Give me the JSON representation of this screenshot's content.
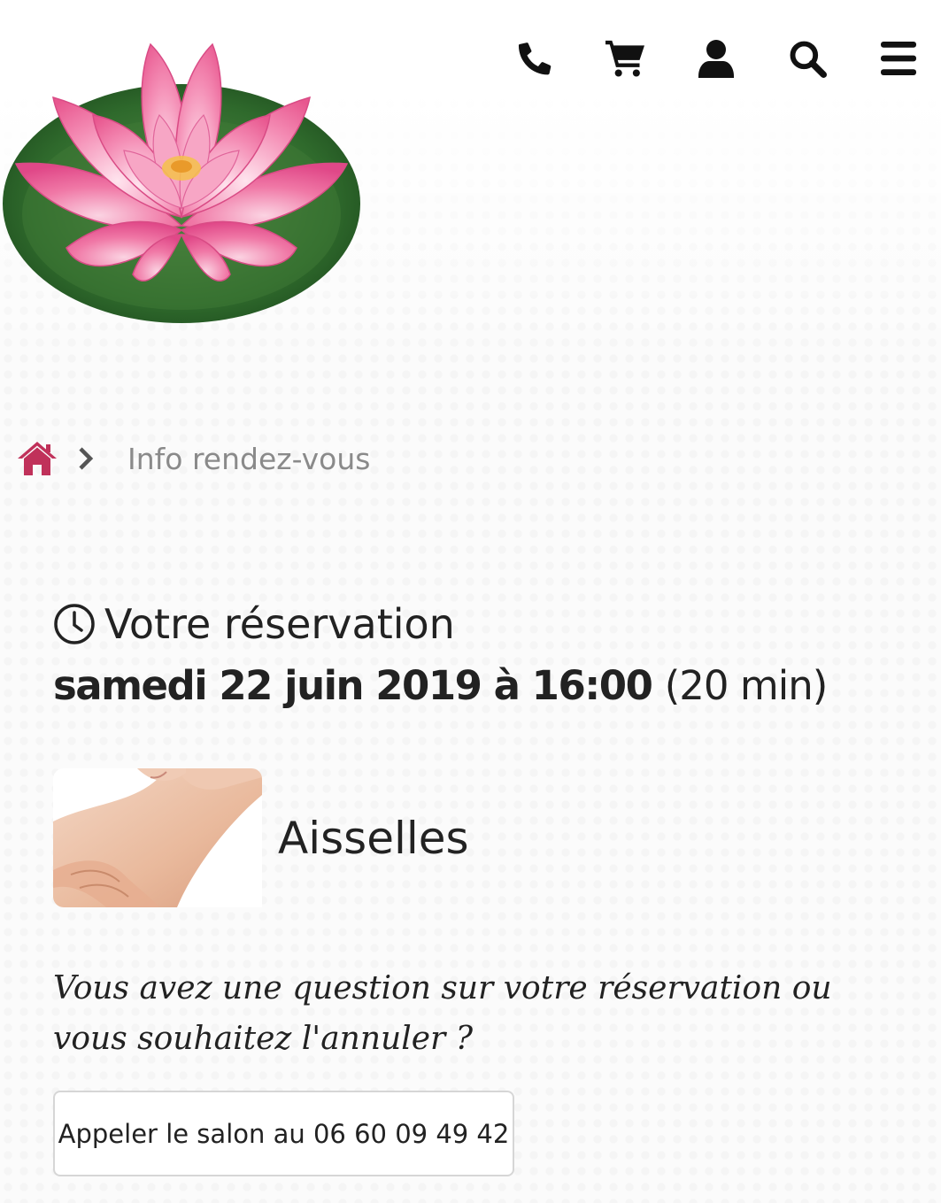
{
  "header": {
    "logo_name": "lotus-flower-logo",
    "nav": [
      {
        "icon": "phone-icon"
      },
      {
        "icon": "cart-icon"
      },
      {
        "icon": "user-icon"
      },
      {
        "icon": "search-icon"
      },
      {
        "icon": "menu-icon"
      }
    ]
  },
  "breadcrumb": {
    "home_icon": "home-icon",
    "current": "Info rendez-vous"
  },
  "reservation": {
    "title": "Votre réservation",
    "date_time": "samedi 22 juin 2019 à 16:00",
    "duration": "(20 min)"
  },
  "service": {
    "name": "Aisselles"
  },
  "question": {
    "text": "Vous avez une question sur votre réservation ou vous souhaitez l'annuler ?"
  },
  "call_button": {
    "label": "Appeler le salon au 06 60 09 49 42"
  },
  "colors": {
    "accent": "#c0315a",
    "text": "#222222",
    "muted": "#8a8a8a"
  }
}
